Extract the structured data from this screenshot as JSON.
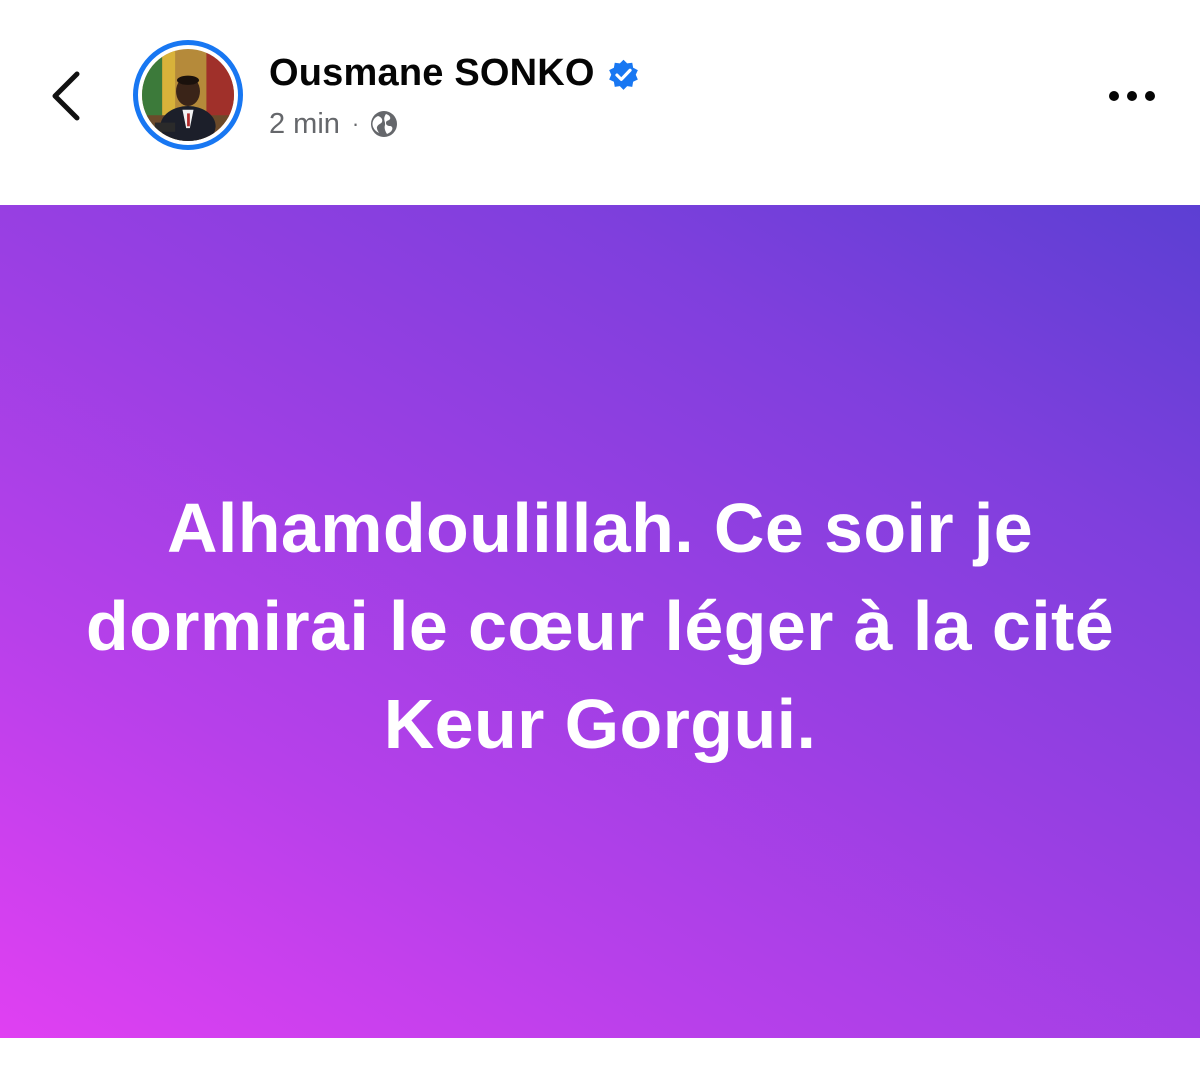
{
  "post": {
    "author_name": "Ousmane SONKO",
    "time": "2 min",
    "separator": "·",
    "audience_icon": "globe-icon",
    "verified_icon": "verified-badge-icon",
    "text": "Alhamdoulillah. Ce soir je dormirai le cœur léger à la cité Keur Gorgui."
  },
  "nav": {
    "back_icon": "chevron-left-icon",
    "more_icon": "more-horizontal-icon"
  },
  "colors": {
    "verified": "#1877f2",
    "gradient_start": "#e040f2",
    "gradient_end": "#5c3fd3",
    "meta_text": "#65676b"
  }
}
